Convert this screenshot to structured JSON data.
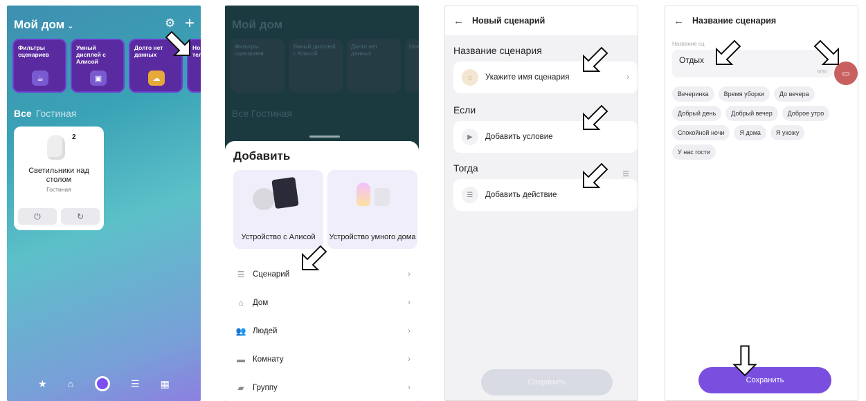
{
  "panel1": {
    "title": "Мой дом",
    "chevron": "⌄",
    "gear": "⚙",
    "plus": "+",
    "cards": [
      {
        "label": "Фильтры сценариев",
        "icon": "☕"
      },
      {
        "label": "Умный дисплей с Алисой",
        "icon": "▣"
      },
      {
        "label": "Долго нет данных",
        "icon": "☁"
      },
      {
        "label": "Нов теле",
        "icon": ""
      }
    ],
    "tabs": [
      "Все",
      "Гостиная"
    ],
    "device": {
      "name": "Светильники над столом",
      "room": "Гостиная",
      "count": "2",
      "power": "⏻",
      "refresh": "↻"
    },
    "nav": {
      "star": "★",
      "home": "⌂",
      "scenes": "☰",
      "grid": "▦"
    }
  },
  "panel2": {
    "title": "Мой дом",
    "dim_cards": [
      "Фильтры сценариев",
      "Умный дисплей с Алисой",
      "Долго нет данных",
      "Нов"
    ],
    "dim_tabs": [
      "Все",
      "Гостиная"
    ],
    "sheet_title": "Добавить",
    "tiles": [
      "Устройство с Алисой",
      "Устройство умного дома"
    ],
    "menu": [
      {
        "label": "Сценарий",
        "icon": "☰"
      },
      {
        "label": "Дом",
        "icon": "⌂"
      },
      {
        "label": "Людей",
        "icon": "👥"
      },
      {
        "label": "Комнату",
        "icon": "▬"
      },
      {
        "label": "Группу",
        "icon": "▰"
      }
    ],
    "arrow": "›"
  },
  "panel3": {
    "back": "←",
    "title": "Новый сценарий",
    "section_name": "Название сценария",
    "name_placeholder": "Укажите имя сценария",
    "section_if": "Если",
    "add_condition": "Добавить условие",
    "section_then": "Тогда",
    "add_action": "Добавить действие",
    "save": "Сохранить",
    "filter_icon": "☰"
  },
  "panel4": {
    "back": "←",
    "title": "Название сценария",
    "field_label": "Название сц",
    "field_value": "Отдых",
    "counter": "5/50",
    "chips": [
      "Вечеринка",
      "Время уборки",
      "До вечера",
      "Добрый день",
      "Добрый вечер",
      "Доброе утро",
      "Спокойной ночи",
      "Я дома",
      "Я ухожу",
      "У нас гости"
    ],
    "save": "Сохранить",
    "icon_button": "▭"
  }
}
